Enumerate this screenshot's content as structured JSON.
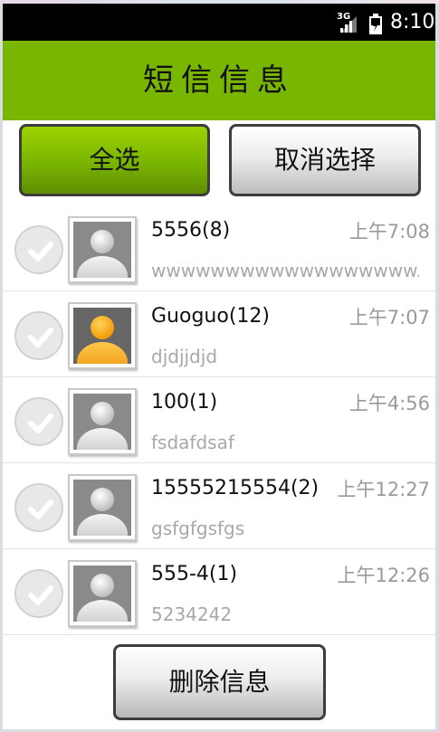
{
  "status_bar": {
    "network": "3G",
    "time": "8:10"
  },
  "header": {
    "title": "短信信息"
  },
  "actions": {
    "select_all": "全选",
    "cancel_selection": "取消选择",
    "delete_messages": "删除信息"
  },
  "messages": [
    {
      "name": "5556(8)",
      "time": "上午7:08",
      "preview": "wwwwwwwwwwwwwwwwww.",
      "avatar": "gray-person-icon"
    },
    {
      "name": "Guoguo(12)",
      "time": "上午7:07",
      "preview": "djdjjdjd",
      "avatar": "orange-person-icon"
    },
    {
      "name": "100(1)",
      "time": "上午4:56",
      "preview": "fsdafdsaf",
      "avatar": "gray-person-icon"
    },
    {
      "name": "15555215554(2)",
      "time": "上午12:27",
      "preview": "gsfgfgsfgs",
      "avatar": "gray-person-icon"
    },
    {
      "name": "555-4(1)",
      "time": "上午12:26",
      "preview": "5234242",
      "avatar": "gray-person-icon"
    }
  ],
  "colors": {
    "header": "#78b600",
    "select_all_button": "#79b400",
    "status_bar": "#000000"
  }
}
